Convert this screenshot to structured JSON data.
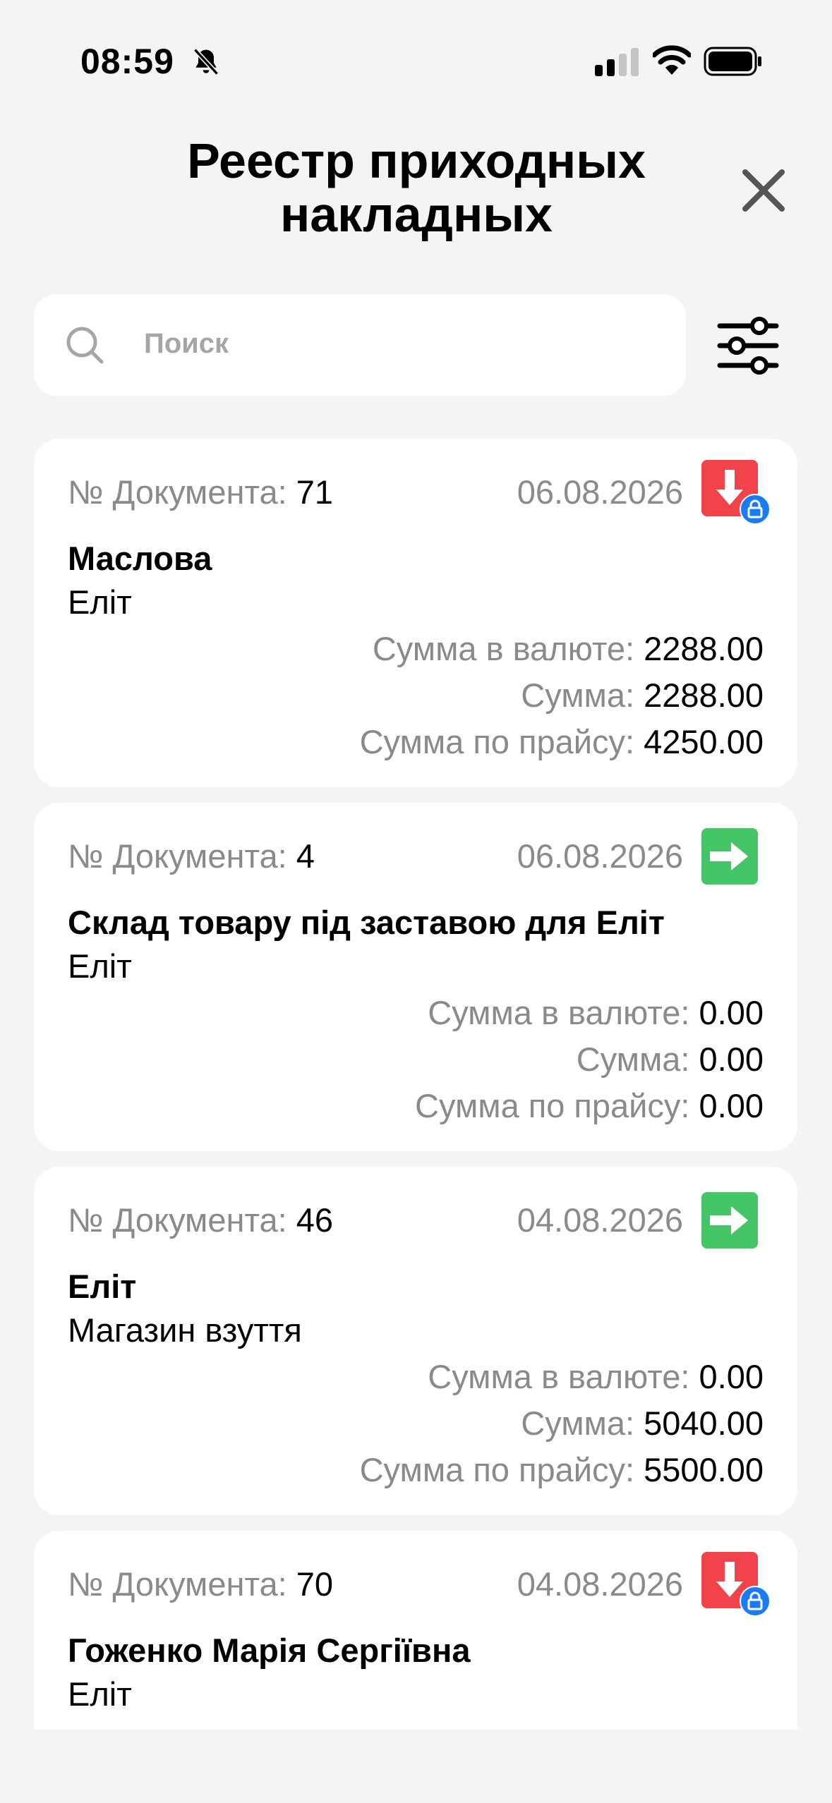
{
  "status_bar": {
    "time": "08:59",
    "icons": [
      "bell-slash-icon",
      "cellular-signal-icon",
      "wifi-icon",
      "battery-icon"
    ]
  },
  "header": {
    "title_line1": "Реестр приходных",
    "title_line2": "накладных",
    "close_icon": "close-icon"
  },
  "search": {
    "placeholder": "Поиск",
    "icon": "search-icon",
    "filter_icon": "sliders-icon"
  },
  "colors": {
    "out_badge": "#f2434a",
    "in_badge": "#44c566",
    "lock_badge": "#1a7cf5",
    "muted_text": "#8a8a8a"
  },
  "labels": {
    "doc_number": "№ Документа: ",
    "sum_currency": "Сумма в валюте: ",
    "sum": "Сумма: ",
    "sum_price": "Сумма по прайсу: "
  },
  "documents": [
    {
      "number": "71",
      "date": "06.08.2026",
      "type_icon": "arrow-down-icon",
      "locked": true,
      "name": "Маслова",
      "subtitle": "Еліт",
      "sum_currency": "2288.00",
      "sum": "2288.00",
      "sum_price": "4250.00"
    },
    {
      "number": "4",
      "date": "06.08.2026",
      "type_icon": "arrow-right-icon",
      "locked": false,
      "name": "Склад товару під заставою для Еліт",
      "subtitle": "Еліт",
      "sum_currency": "0.00",
      "sum": "0.00",
      "sum_price": "0.00"
    },
    {
      "number": "46",
      "date": "04.08.2026",
      "type_icon": "arrow-right-icon",
      "locked": false,
      "name": "Еліт",
      "subtitle": "Магазин взуття",
      "sum_currency": "0.00",
      "sum": "5040.00",
      "sum_price": "5500.00"
    },
    {
      "number": "70",
      "date": "04.08.2026",
      "type_icon": "arrow-down-icon",
      "locked": true,
      "name": "Гоженко Марія Сергіївна",
      "subtitle": "Еліт"
    }
  ]
}
